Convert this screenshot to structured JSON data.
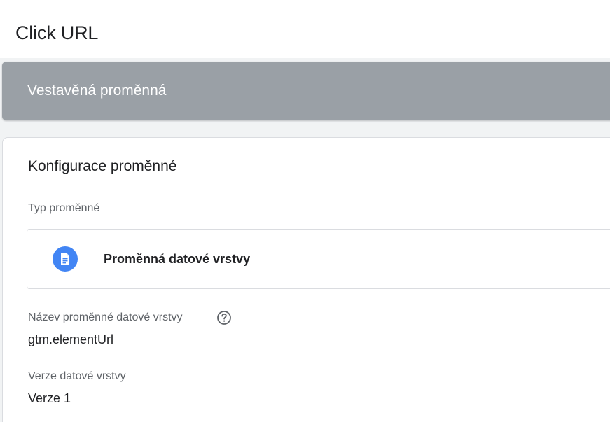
{
  "header": {
    "title": "Click URL"
  },
  "variable": {
    "builtin_label": "Vestavěná proměnná"
  },
  "configuration": {
    "title": "Konfigurace proměnné",
    "type_label": "Typ proměnné",
    "type_value": "Proměnná datové vrstvy",
    "type_icon": "document-icon",
    "name_label": "Název proměnné datové vrstvy",
    "name_help_icon": "help-circle-icon",
    "name_value": "gtm.elementUrl",
    "version_label": "Verze datové vrstvy",
    "version_value": "Verze 1"
  },
  "colors": {
    "banner": "#9aa0a6",
    "type_icon_bg": "#4285f4",
    "background": "#f1f3f4"
  }
}
